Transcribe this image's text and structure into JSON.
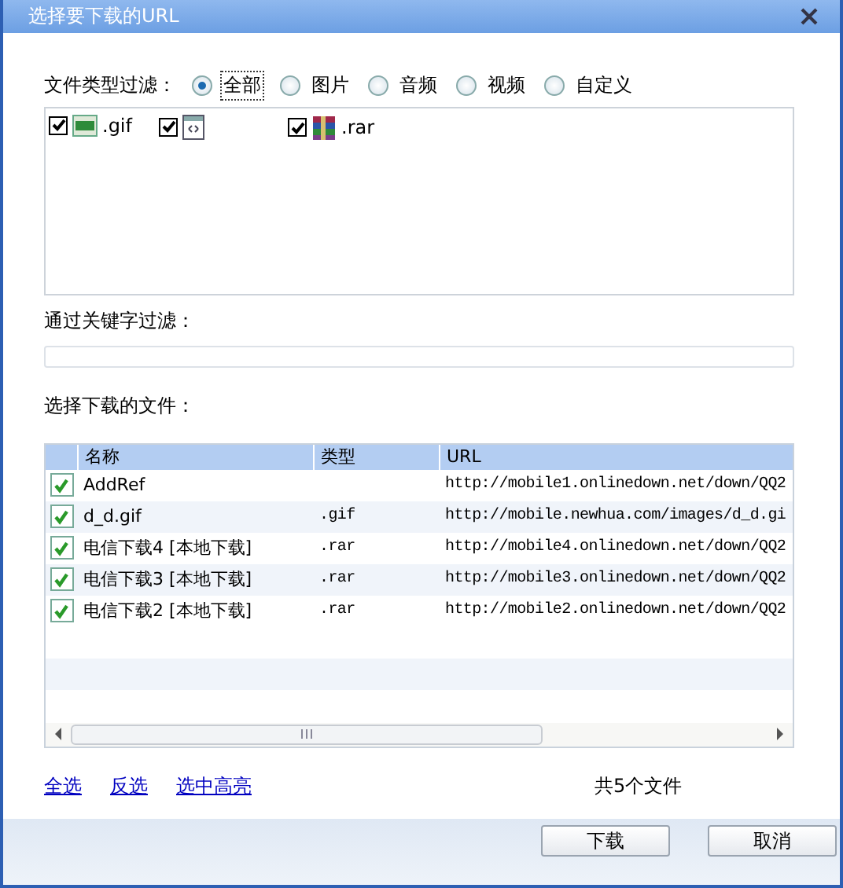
{
  "window": {
    "title": "选择要下载的URL"
  },
  "type_filter": {
    "label": "文件类型过滤：",
    "options": [
      {
        "label": "全部",
        "selected": true
      },
      {
        "label": "图片",
        "selected": false
      },
      {
        "label": "音频",
        "selected": false
      },
      {
        "label": "视频",
        "selected": false
      },
      {
        "label": "自定义",
        "selected": false
      }
    ]
  },
  "file_types": [
    {
      "kind": "gif",
      "label": ".gif",
      "checked": true
    },
    {
      "kind": "page",
      "checked": true
    },
    {
      "kind": "rar",
      "label": ".rar",
      "checked": true
    }
  ],
  "keyword_filter": {
    "label": "通过关键字过滤："
  },
  "files": {
    "label": "选择下载的文件：",
    "columns": [
      "名称",
      "类型",
      "URL"
    ],
    "rows": [
      {
        "checked": true,
        "name": "AddRef",
        "url": "http://mobile1.onlinedown.net/down/QQ2"
      },
      {
        "checked": true,
        "name": "d_d.gif",
        "type": ".gif",
        "url": "http://mobile.newhua.com/images/d_d.gi"
      },
      {
        "checked": true,
        "name": "电信下载4 [本地下载]",
        "type": ".rar",
        "url": "http://mobile4.onlinedown.net/down/QQ2"
      },
      {
        "checked": true,
        "name": "电信下载3 [本地下载]",
        "type": ".rar",
        "url": "http://mobile3.onlinedown.net/down/QQ2"
      },
      {
        "checked": true,
        "name": "电信下载2 [本地下载]",
        "type": ".rar",
        "url": "http://mobile2.onlinedown.net/down/QQ2"
      }
    ]
  },
  "links": [
    "全选",
    "反选",
    "选中高亮"
  ],
  "count": "共5个文件",
  "buttons": [
    "下载",
    "取消"
  ]
}
